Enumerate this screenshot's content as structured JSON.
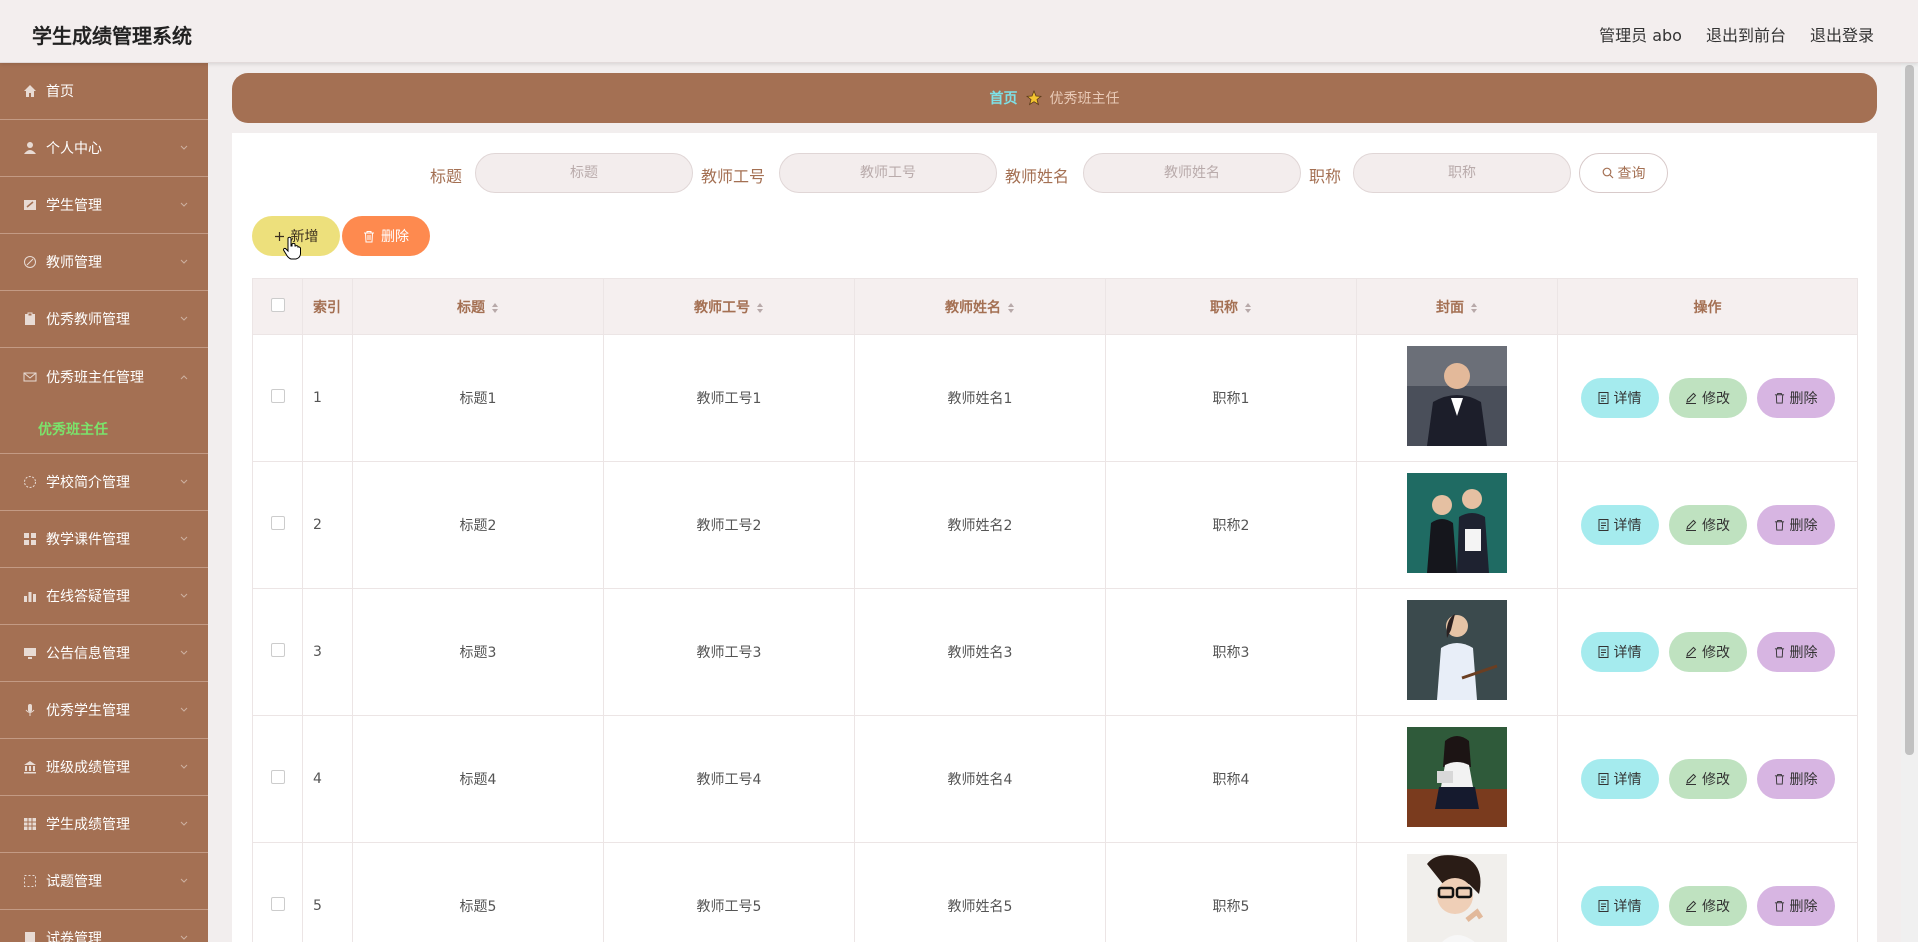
{
  "header": {
    "app_title": "学生成绩管理系统",
    "links": [
      "管理员 abo",
      "退出到前台",
      "退出登录"
    ]
  },
  "sidebar": {
    "items": [
      {
        "label": "首页",
        "icon": "home-icon"
      },
      {
        "label": "个人中心",
        "icon": "user-icon"
      },
      {
        "label": "学生管理",
        "icon": "edit-icon"
      },
      {
        "label": "教师管理",
        "icon": "pen-icon"
      },
      {
        "label": "优秀教师管理",
        "icon": "clipboard-icon"
      },
      {
        "label": "优秀班主任管理",
        "icon": "mail-icon",
        "expanded": true
      },
      {
        "label": "学校简介管理",
        "icon": "globe-icon"
      },
      {
        "label": "教学课件管理",
        "icon": "grid-icon"
      },
      {
        "label": "在线答疑管理",
        "icon": "bar-chart-icon"
      },
      {
        "label": "公告信息管理",
        "icon": "monitor-icon"
      },
      {
        "label": "优秀学生管理",
        "icon": "microphone-icon"
      },
      {
        "label": "班级成绩管理",
        "icon": "bank-icon"
      },
      {
        "label": "学生成绩管理",
        "icon": "table-icon"
      },
      {
        "label": "试题管理",
        "icon": "dashed-square-icon"
      },
      {
        "label": "试卷管理",
        "icon": "doc-icon"
      }
    ],
    "active_sub": "优秀班主任"
  },
  "breadcrumb": {
    "home": "首页",
    "current": "优秀班主任"
  },
  "search": {
    "fields": [
      {
        "label": "标题",
        "placeholder": "标题"
      },
      {
        "label": "教师工号",
        "placeholder": "教师工号"
      },
      {
        "label": "教师姓名",
        "placeholder": "教师姓名"
      },
      {
        "label": "职称",
        "placeholder": "职称"
      }
    ],
    "query_label": "查询"
  },
  "actions": {
    "add_label": "新增",
    "delete_label": "删除"
  },
  "table": {
    "columns": [
      "索引",
      "标题",
      "教师工号",
      "教师姓名",
      "职称",
      "封面",
      "操作"
    ],
    "rows": [
      {
        "index": "1",
        "title": "标题1",
        "no": "教师工号1",
        "name": "教师姓名1",
        "rank": "职称1"
      },
      {
        "index": "2",
        "title": "标题2",
        "no": "教师工号2",
        "name": "教师姓名2",
        "rank": "职称2"
      },
      {
        "index": "3",
        "title": "标题3",
        "no": "教师工号3",
        "name": "教师姓名3",
        "rank": "职称3"
      },
      {
        "index": "4",
        "title": "标题4",
        "no": "教师工号4",
        "name": "教师姓名4",
        "rank": "职称4"
      },
      {
        "index": "5",
        "title": "标题5",
        "no": "教师工号5",
        "name": "教师姓名5",
        "rank": "职称5"
      }
    ],
    "row_actions": {
      "detail": "详情",
      "edit": "修改",
      "delete": "删除"
    }
  },
  "colors": {
    "primary": "#a47053",
    "add_button": "#ede07c",
    "delete_button": "#fe8a4f",
    "detail_button": "#a5ebee",
    "edit_button": "#bfe2c0",
    "row_delete_button": "#d7b5e2",
    "active_sub": "#7be36b"
  }
}
